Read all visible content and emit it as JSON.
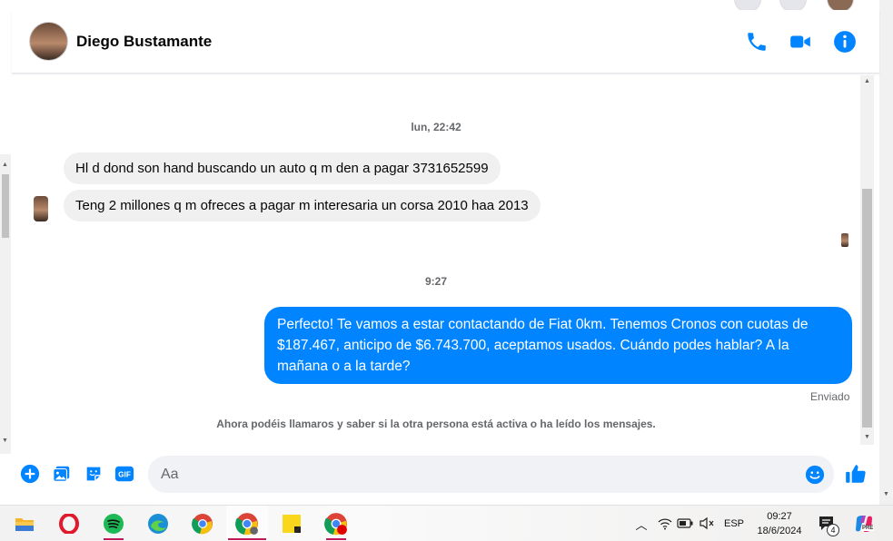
{
  "contact": {
    "name": "Diego Bustamante"
  },
  "header_icons": [
    "phone-icon",
    "video-camera-icon",
    "info-icon"
  ],
  "timestamps": {
    "first": "lun, 22:42",
    "second": "9:27"
  },
  "messages_in": [
    {
      "text": "Hl d dond son hand buscando un auto q m den a pagar 3731652599"
    },
    {
      "text": "Teng 2 millones q m ofreces a pagar m interesaria un corsa 2010 haa 2013"
    }
  ],
  "message_out": {
    "text": "Perfecto! Te vamos a estar contactando de Fiat 0km. Tenemos Cronos con cuotas de $187.467, anticipo de $6.743.700, aceptamos usados. Cuándo podes hablar? A la mañana o a la tarde?"
  },
  "status": {
    "sent": "Enviado"
  },
  "notice": "Ahora podéis llamaros y saber si la otra persona está activa o ha leído los mensajes.",
  "composer": {
    "placeholder": "Aa",
    "icons": [
      "plus-icon",
      "photo-icon",
      "sticker-icon",
      "gif-icon",
      "emoji-icon",
      "thumbs-up-icon"
    ],
    "gif_label": "GIF"
  },
  "taskbar": {
    "apps": [
      "file-explorer",
      "opera",
      "spotify",
      "edge",
      "chrome",
      "chrome-profile",
      "sticky-notes",
      "chrome-notification"
    ],
    "language": "ESP",
    "time": "09:27",
    "date": "18/6/2024",
    "notification_count": "4",
    "copilot_badge": "PRE"
  },
  "colors": {
    "accent": "#0084ff",
    "bubble_in": "#f0f0f0",
    "text_muted": "#65676b"
  }
}
